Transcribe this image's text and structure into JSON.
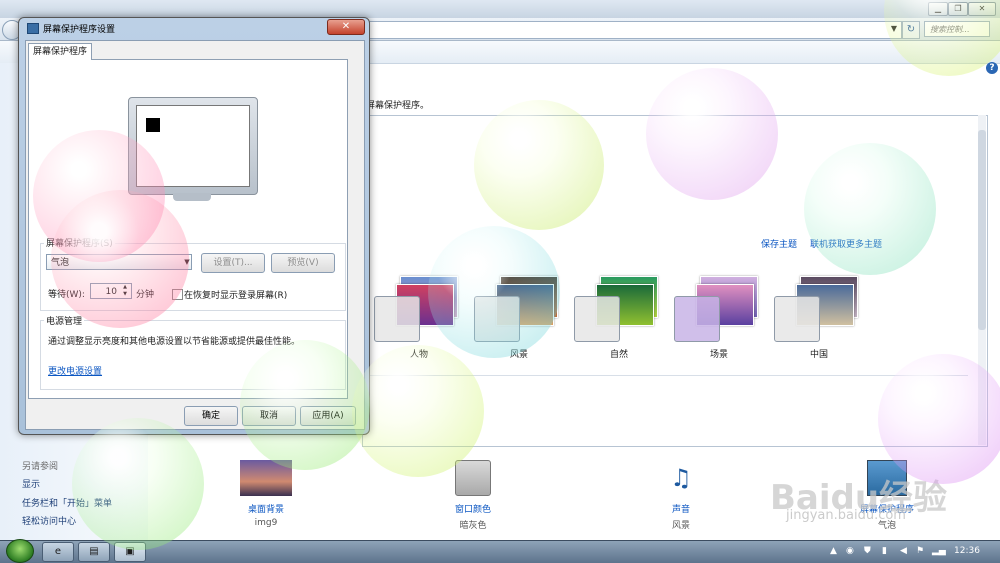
{
  "background_window": {
    "search_placeholder": "搜索控制...",
    "help_glyph": "?",
    "instruction_text": "屏幕保护程序。",
    "links": {
      "save_theme": "保存主题",
      "get_more_themes": "联机获取更多主题"
    },
    "themes": [
      {
        "label": "人物"
      },
      {
        "label": "风景"
      },
      {
        "label": "自然"
      },
      {
        "label": "场景"
      },
      {
        "label": "中国"
      }
    ],
    "see_also": {
      "heading": "另请参阅",
      "links": [
        "显示",
        "任务栏和「开始」菜单",
        "轻松访问中心"
      ]
    },
    "bottom_items": [
      {
        "label": "桌面背景",
        "sub": "img9"
      },
      {
        "label": "窗口颜色",
        "sub": "暗灰色"
      },
      {
        "label": "声音",
        "sub": "风景"
      },
      {
        "label": "屏幕保护程序",
        "sub": "气泡"
      }
    ]
  },
  "dialog": {
    "title": "屏幕保护程序设置",
    "close_glyph": "✕",
    "tab": "屏幕保护程序",
    "screensaver_group_label": "屏幕保护程序(S)",
    "selected_screensaver": "气泡",
    "settings_button": "设置(T)...",
    "preview_button": "预览(V)",
    "wait_label": "等待(W):",
    "wait_value": "10",
    "minutes_label": "分钟",
    "resume_label": "在恢复时显示登录屏幕(R)",
    "resume_checked": false,
    "power_group_label": "电源管理",
    "power_desc": "通过调整显示亮度和其他电源设置以节省能源或提供最佳性能。",
    "power_link": "更改电源设置",
    "ok_button": "确定",
    "cancel_button": "取消",
    "apply_button": "应用(A)"
  },
  "taskbar": {
    "clock": "12:36"
  },
  "watermark": {
    "brand": "Baidu经验",
    "url": "jingyan.baidu.com"
  }
}
